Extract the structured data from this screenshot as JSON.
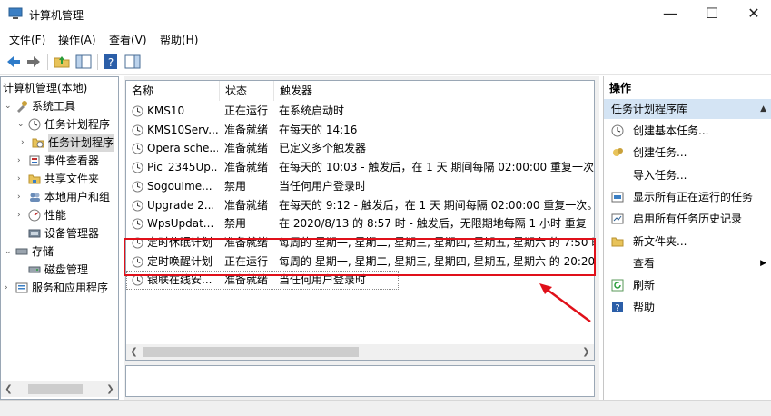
{
  "window": {
    "title": "计算机管理",
    "minimize": "—",
    "maximize": "☐",
    "close": "✕"
  },
  "menu": [
    "文件(F)",
    "操作(A)",
    "查看(V)",
    "帮助(H)"
  ],
  "tree": [
    {
      "label": "计算机管理(本地)",
      "indent": 0,
      "arrow": "",
      "icon": "computer-icon"
    },
    {
      "label": "系统工具",
      "indent": 1,
      "arrow": "⌄",
      "icon": "tools-icon"
    },
    {
      "label": "任务计划程序",
      "indent": 2,
      "arrow": "⌄",
      "icon": "clock-icon"
    },
    {
      "label": "任务计划程序",
      "indent": 3,
      "arrow": "›",
      "icon": "folder-icon",
      "selected": true
    },
    {
      "label": "事件查看器",
      "indent": 2,
      "arrow": "›",
      "icon": "event-viewer-icon"
    },
    {
      "label": "共享文件夹",
      "indent": 2,
      "arrow": "›",
      "icon": "shared-folder-icon"
    },
    {
      "label": "本地用户和组",
      "indent": 2,
      "arrow": "›",
      "icon": "users-icon"
    },
    {
      "label": "性能",
      "indent": 2,
      "arrow": "›",
      "icon": "performance-icon"
    },
    {
      "label": "设备管理器",
      "indent": 2,
      "arrow": "",
      "icon": "device-manager-icon"
    },
    {
      "label": "存储",
      "indent": 1,
      "arrow": "⌄",
      "icon": "storage-icon"
    },
    {
      "label": "磁盘管理",
      "indent": 2,
      "arrow": "",
      "icon": "disk-icon"
    },
    {
      "label": "服务和应用程序",
      "indent": 1,
      "arrow": "›",
      "icon": "services-icon"
    }
  ],
  "list": {
    "columns": [
      "名称",
      "状态",
      "触发器"
    ],
    "rows": [
      {
        "name": "KMS10",
        "status": "正在运行",
        "trigger": "在系统启动时"
      },
      {
        "name": "KMS10Serv...",
        "status": "准备就绪",
        "trigger": "在每天的 14:16"
      },
      {
        "name": "Opera sche...",
        "status": "准备就绪",
        "trigger": "已定义多个触发器"
      },
      {
        "name": "Pic_2345Up...",
        "status": "准备就绪",
        "trigger": "在每天的 10:03 - 触发后，在 1 天 期间每隔 02:00:00 重复一次。"
      },
      {
        "name": "SogouIme...",
        "status": "禁用",
        "trigger": "当任何用户登录时"
      },
      {
        "name": "Upgrade 2...",
        "status": "准备就绪",
        "trigger": "在每天的 9:12 - 触发后，在 1 天 期间每隔 02:00:00 重复一次。"
      },
      {
        "name": "WpsUpdat...",
        "status": "禁用",
        "trigger": "在 2020/8/13 的 8:57 时 - 触发后，无限期地每隔 1 小时 重复一"
      },
      {
        "name": "定时休眠计划",
        "status": "准备就绪",
        "trigger": "每周的 星期一, 星期二, 星期三, 星期四, 星期五, 星期六 的 7:50 时"
      },
      {
        "name": "定时唤醒计划",
        "status": "正在运行",
        "trigger": "每周的 星期一, 星期二, 星期三, 星期四, 星期五, 星期六 的 20:20 时"
      },
      {
        "name": "银联在线安...",
        "status": "准备就绪",
        "trigger": "当任何用户登录时"
      }
    ]
  },
  "actions": {
    "header": "操作",
    "section": "任务计划程序库",
    "section_arrow": "▲",
    "items": [
      {
        "label": "创建基本任务...",
        "icon": "create-basic-task-icon"
      },
      {
        "label": "创建任务...",
        "icon": "create-task-icon"
      },
      {
        "label": "导入任务...",
        "icon": ""
      },
      {
        "label": "显示所有正在运行的任务",
        "icon": "running-tasks-icon"
      },
      {
        "label": "启用所有任务历史记录",
        "icon": "history-icon"
      },
      {
        "label": "新文件夹...",
        "icon": "new-folder-icon"
      },
      {
        "label": "查看",
        "icon": "",
        "submenu": "▶"
      },
      {
        "label": "刷新",
        "icon": "refresh-icon"
      },
      {
        "label": "帮助",
        "icon": "help-icon"
      }
    ]
  },
  "colors": {
    "highlight": "#e0101a",
    "selection": "#d4e4f4",
    "accent": "#1f6fb5"
  }
}
